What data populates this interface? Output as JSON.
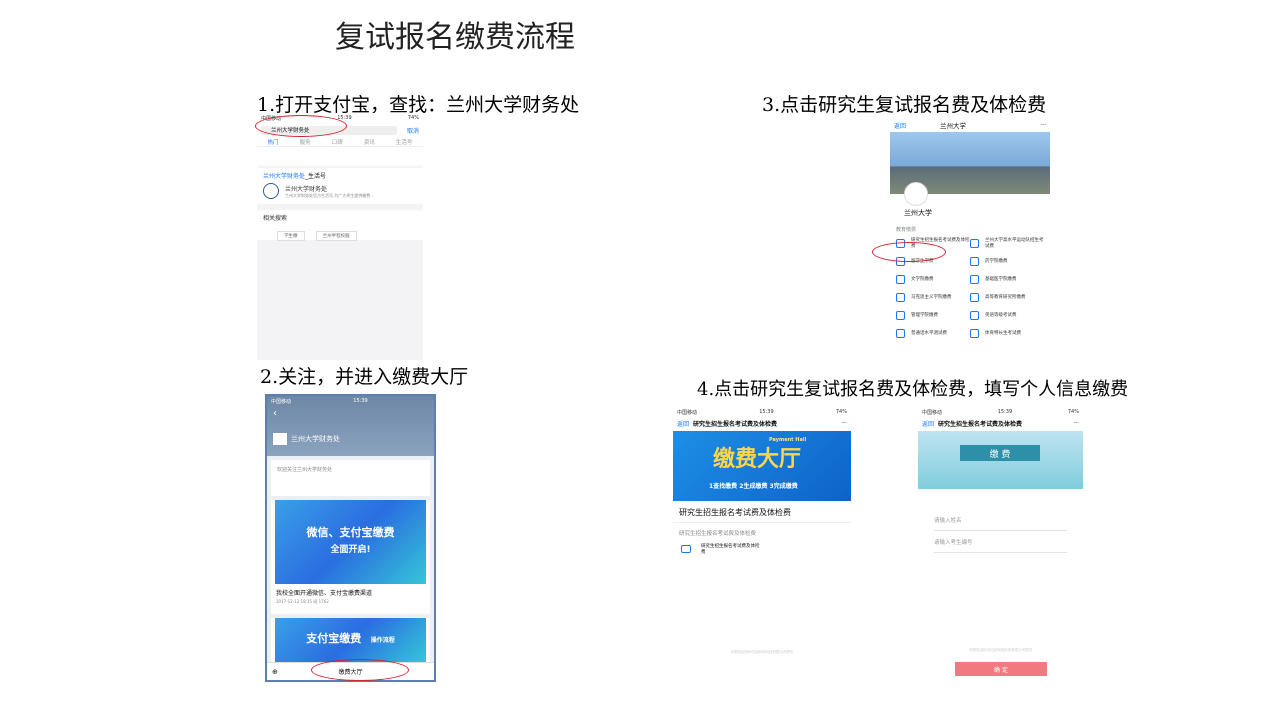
{
  "title": "复试报名缴费流程",
  "steps": {
    "s1": "1.打开支付宝，查找：兰州大学财务处",
    "s2": "2.关注，并进入缴费大厅",
    "s3": "3.点击研究生复试报名费及体检费",
    "s4": "4.点击研究生复试报名费及体检费，填写个人信息缴费"
  },
  "screen1": {
    "status_carrier": "中国移动",
    "status_time": "15:39",
    "status_battery": "74%",
    "search_value": "兰州大学财务处",
    "cancel": "取消",
    "tabs": [
      "热门",
      "服务",
      "口碑",
      "资讯",
      "生活号"
    ],
    "result_link": "兰州大学财务处",
    "result_suffix": "_生活号",
    "result_name": "兰州大学财务处",
    "result_desc": "兰州大学财务处官方生活号,为广大师生提供缴费…",
    "related_title": "相关搜索",
    "related_chips": [
      "学生缴",
      "兰州半程校服"
    ]
  },
  "screen2": {
    "status_carrier": "中国移动",
    "status_time": "15:39",
    "account": "兰州大学财务处",
    "welcome": "欢迎关注兰州大学财务处",
    "banner_a_l1": "微信、支付宝缴费",
    "banner_a_l2": "全面开启!",
    "article_title": "我校全面开通微信、支付宝缴费渠道",
    "article_meta": "2017-12-12 18:15   阅 1762",
    "banner_b": "支付宝缴费",
    "banner_b_tag": "操作流程",
    "hall_button": "缴费大厅"
  },
  "screen3": {
    "back": "返回",
    "title": "兰州大学",
    "school": "兰州大学",
    "section": "教育缴费",
    "items": [
      "研究生招生报名考试费及体检费",
      "兰州大学高水平运动队招生考试费",
      "留学生学费",
      "药学院缴费",
      "文学院缴费",
      "基础医学院缴费",
      "马克思主义学院缴费",
      "高等教育研究所缴费",
      "管理学院缴费",
      "英语等级考试费",
      "普通话水平测试费",
      "体育特长生考试费"
    ]
  },
  "screen4a": {
    "status_carrier": "中国移动",
    "status_time": "15:39",
    "status_battery": "74%",
    "back": "返回",
    "nav_title": "研究生招生报名考试费及体检费",
    "hall_big": "缴费大厅",
    "hall_en": "Payment Hall",
    "hall_steps": "1查找缴费 2生成缴费 3完成缴费",
    "page_title": "研究生招生报名考试费及体检费",
    "subtitle": "研究生招生报名考试费及体检费",
    "item": "研究生招生报名考试费及体检费",
    "footer": "本服务由杭州亿起网络科技有限公司提供"
  },
  "screen4b": {
    "status_carrier": "中国移动",
    "status_time": "15:39",
    "status_battery": "74%",
    "back": "返回",
    "nav_title": "研究生招生报名考试费及体检费",
    "banner": "缴 费",
    "name_placeholder": "请输入姓名",
    "id_placeholder": "请输入考生编号",
    "footer": "本服务由杭州亿起网络科技有限公司提供",
    "confirm": "确 定"
  }
}
